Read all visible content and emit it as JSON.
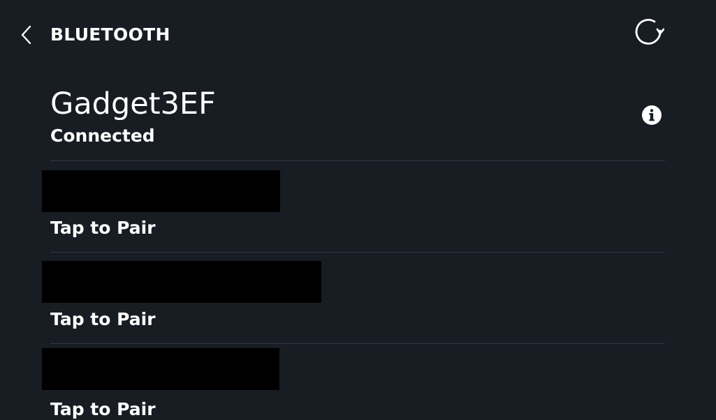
{
  "header": {
    "title": "BLUETOOTH",
    "back_icon": "chevron-left-icon",
    "refresh_icon": "refresh-icon"
  },
  "connected_device": {
    "name": "Gadget3EF",
    "status": "Connected",
    "info_icon": "info-icon"
  },
  "available_devices": [
    {
      "name": "",
      "status": "Tap to Pair",
      "name_redacted": true
    },
    {
      "name": "",
      "status": "Tap to Pair",
      "name_redacted": true
    },
    {
      "name": "",
      "status": "Tap to Pair",
      "name_redacted": true
    }
  ],
  "colors": {
    "background": "#181c23",
    "text": "#ffffff",
    "divider": "#323843",
    "redaction": "#000000"
  }
}
